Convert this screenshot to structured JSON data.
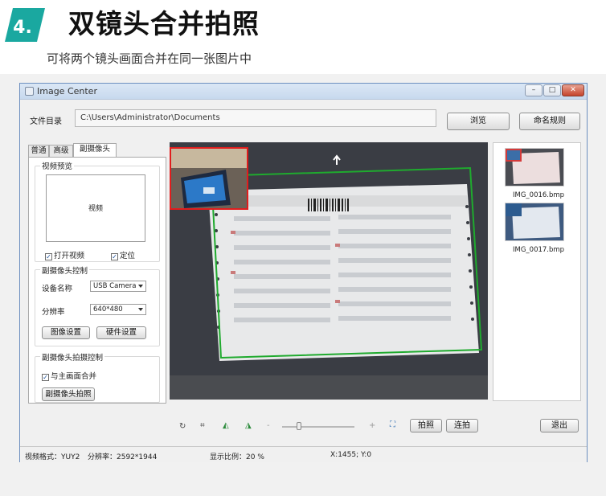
{
  "header": {
    "badge_number": "4.",
    "title": "双镜头合并拍照",
    "subtitle": "可将两个镜头画面合并在同一张图片中"
  },
  "window": {
    "title": "Image Center",
    "controls": {
      "minimize": "–",
      "maximize": "□",
      "close": "✕"
    }
  },
  "file_dir": {
    "label": "文件目录",
    "path": "C:\\Users\\Administrator\\Documents",
    "browse_label": "浏览",
    "naming_label": "命名规则"
  },
  "tabs": [
    {
      "label": "普通",
      "active": false
    },
    {
      "label": "高级",
      "active": false
    },
    {
      "label": "副摄像头",
      "active": true
    }
  ],
  "video_preview": {
    "group_title": "视频预览",
    "preview_text": "视频",
    "open_video_label": "打开视频",
    "open_video_checked": true,
    "position_label": "定位",
    "position_checked": true
  },
  "camera_control": {
    "group_title": "副摄像头控制",
    "device_label": "设备名称",
    "device_value": "USB Camera",
    "resolution_label": "分辨率",
    "resolution_value": "640*480",
    "image_settings_label": "图像设置",
    "hardware_settings_label": "硬件设置"
  },
  "capture_control": {
    "group_title": "副摄像头拍摄控制",
    "merge_label": "与主画面合并",
    "merge_checked": true,
    "capture_button_label": "副摄像头拍照"
  },
  "thumbnails": [
    {
      "name": "IMG_0016.bmp"
    },
    {
      "name": "IMG_0017.bmp"
    }
  ],
  "bottom": {
    "shoot_label": "拍照",
    "burst_label": "连拍",
    "exit_label": "退出",
    "icons": [
      "rotate-icon",
      "crop-icon",
      "rotate-left-icon",
      "rotate-right-icon",
      "zoom-out-icon",
      "zoom-in-icon",
      "fit-icon"
    ]
  },
  "status": {
    "video_format": "视频格式：YUY2",
    "resolution": "分辨率：2592*1944",
    "display_ratio": "显示比例：20 %",
    "coords": "X:1455; Y:0"
  },
  "colors": {
    "badge": "#1aa8a0",
    "frame_green": "#1faa2e",
    "pip_red": "#e01d1d",
    "window_border": "#6c8fbf"
  }
}
